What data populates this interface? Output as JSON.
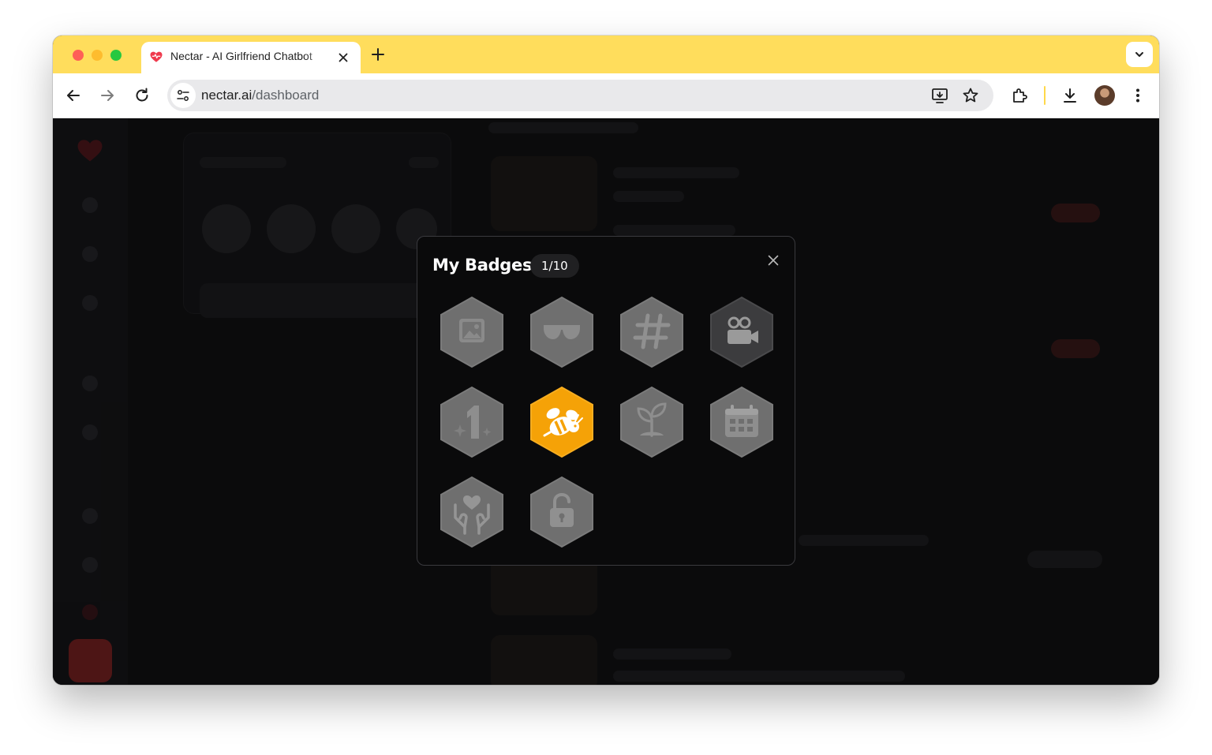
{
  "browser": {
    "tab_title": "Nectar - AI Girlfriend Chatbot",
    "url_host": "nectar.ai",
    "url_path": "/dashboard",
    "accent_color": "#ffdd5c"
  },
  "modal": {
    "title": "My Badges",
    "count": "1/10",
    "badges": [
      {
        "icon": "image-icon",
        "state": "locked"
      },
      {
        "icon": "sunglasses-icon",
        "state": "locked"
      },
      {
        "icon": "hashtag-icon",
        "state": "locked"
      },
      {
        "icon": "video-camera-icon",
        "state": "locked"
      },
      {
        "icon": "number-one-sparkle-icon",
        "state": "locked"
      },
      {
        "icon": "bee-icon",
        "state": "earned",
        "color": "#f5a207"
      },
      {
        "icon": "sprout-icon",
        "state": "locked"
      },
      {
        "icon": "calendar-icon",
        "state": "locked"
      },
      {
        "icon": "heart-hands-icon",
        "state": "locked"
      },
      {
        "icon": "padlock-icon",
        "state": "locked"
      }
    ]
  }
}
